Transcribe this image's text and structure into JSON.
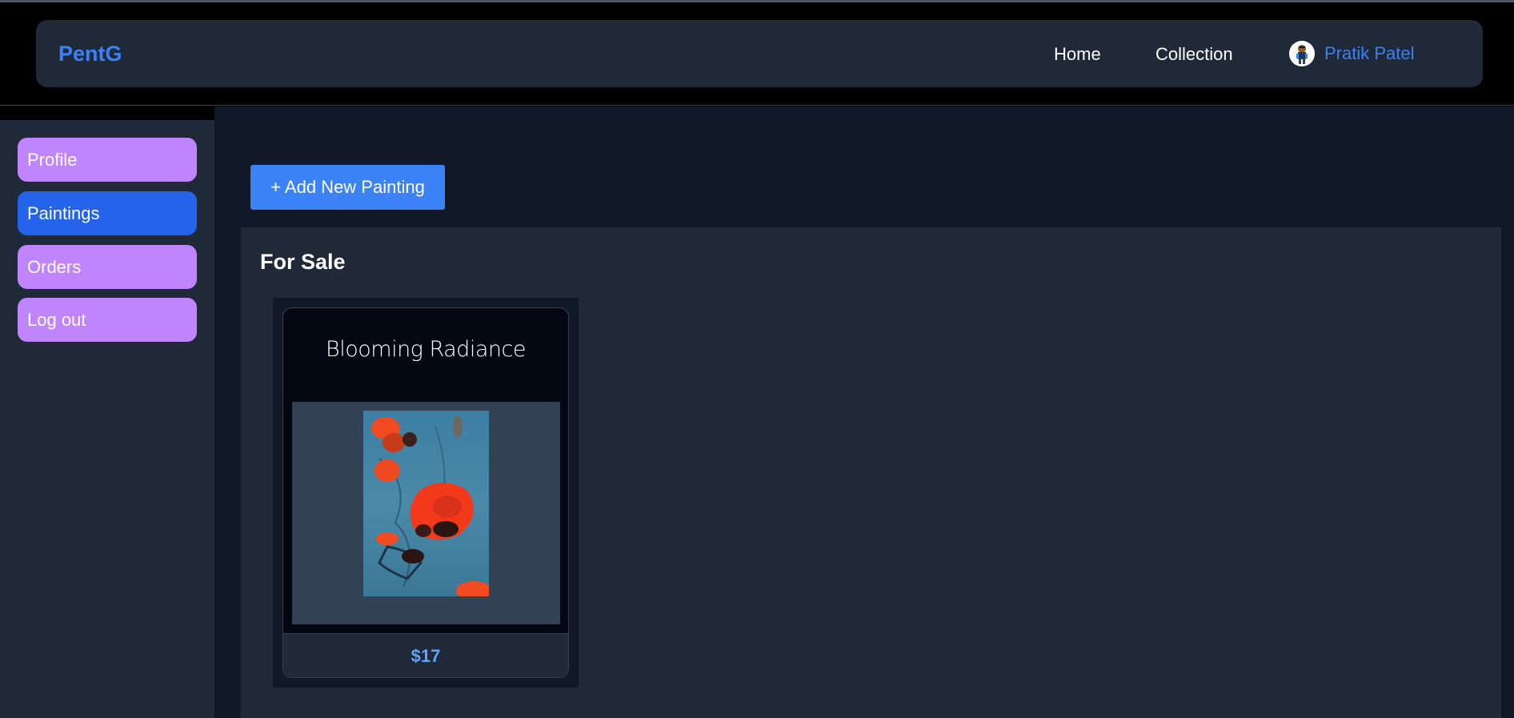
{
  "header": {
    "brand": "PentG",
    "nav": {
      "home": "Home",
      "collection": "Collection",
      "user_name": "Pratik Patel"
    }
  },
  "sidebar": {
    "items": [
      {
        "label": "Profile",
        "active": false
      },
      {
        "label": "Paintings",
        "active": true
      },
      {
        "label": "Orders",
        "active": false
      },
      {
        "label": "Log out",
        "active": false
      }
    ]
  },
  "main": {
    "add_button": "+ Add New Painting",
    "section_title": "For Sale",
    "paintings": [
      {
        "title": "Blooming Radiance",
        "price": "$17",
        "image": "abstract-red-poppies-painting"
      }
    ]
  },
  "colors": {
    "brand": "#3b82f6",
    "sidebar_item": "#c084fc",
    "sidebar_active": "#2563eb",
    "price": "#60a5fa"
  }
}
